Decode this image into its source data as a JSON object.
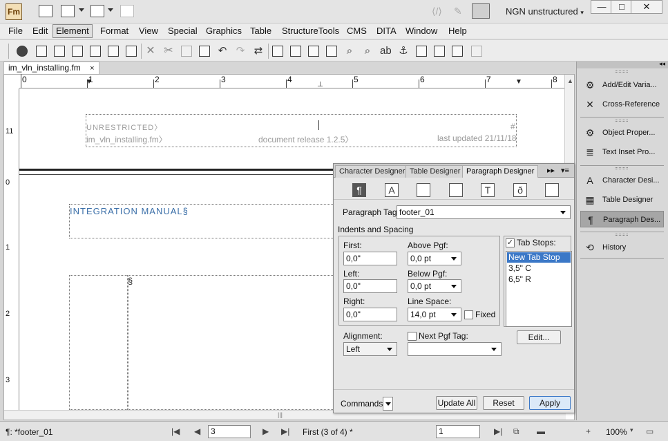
{
  "titlebar": {
    "logo": "Fm",
    "workspace": "NGN unstructured",
    "minimize": "—",
    "maximize": "□",
    "close": "✕"
  },
  "menu": [
    "File",
    "Edit",
    "Element",
    "Format",
    "View",
    "Special",
    "Graphics",
    "Table",
    "StructureTools",
    "CMS",
    "DITA",
    "Window",
    "Help"
  ],
  "menu_active": "Element",
  "document": {
    "tab_title": "im_vln_installing.fm",
    "tab_close": "×",
    "ruler_numbers": [
      "0",
      "1",
      "2",
      "3",
      "4",
      "5",
      "6",
      "7",
      "8"
    ],
    "vruler_numbers": [
      "11",
      "0",
      "1",
      "2",
      "3"
    ],
    "footer": {
      "line1_left": "UNRESTRICTED〉",
      "line1_right": "#",
      "line2_left": "im_vln_installing.fm〉",
      "line2_center": "document release 1.2.5〉",
      "line2_right": "last updated 21/11/18"
    },
    "heading": "INTEGRATION MANUAL§",
    "section_mark": "§"
  },
  "paragraph_designer": {
    "tabs": [
      "Character Designer",
      "Table Designer",
      "Paragraph Designer"
    ],
    "active_tab": "Paragraph Designer",
    "paragraph_tag_label": "Paragraph Tag:",
    "paragraph_tag_value": "footer_01",
    "indents_label": "Indents and Spacing",
    "first_label": "First:",
    "first_value": "0,0\"",
    "left_label": "Left:",
    "left_value": "0,0\"",
    "right_label": "Right:",
    "right_value": "0,0\"",
    "above_label": "Above Pgf:",
    "above_value": "0,0 pt",
    "below_label": "Below Pgf:",
    "below_value": "0,0 pt",
    "linespace_label": "Line Space:",
    "linespace_value": "14,0 pt",
    "fixed_label": "Fixed",
    "tabstops_label": "Tab Stops:",
    "tabstops": [
      "New Tab Stop",
      "3,5\"  C",
      "6,5\"  R"
    ],
    "alignment_label": "Alignment:",
    "alignment_value": "Left",
    "next_pgf_label": "Next Pgf Tag:",
    "next_pgf_value": "",
    "edit_button": "Edit...",
    "commands_label": "Commands:",
    "update_all": "Update All",
    "reset": "Reset",
    "apply": "Apply"
  },
  "right_panel": {
    "items": [
      "Add/Edit Varia...",
      "Cross-Reference",
      "Object Proper...",
      "Text Inset Pro...",
      "Character Desi...",
      "Table Designer",
      "Paragraph Des...",
      "History"
    ],
    "active": "Paragraph Des..."
  },
  "statusbar": {
    "tag": "¶: *footer_01",
    "page_input": "3",
    "page_info": "First (3 of 4) *",
    "field2": "1",
    "zoom": "100%"
  }
}
